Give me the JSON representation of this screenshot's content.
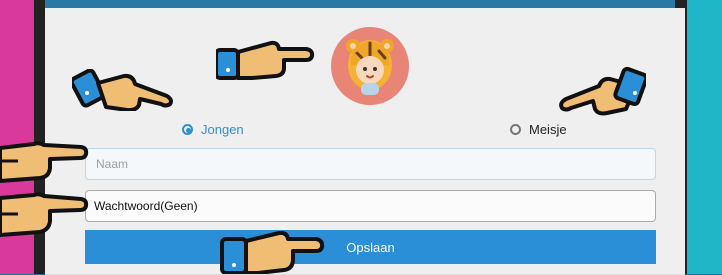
{
  "gender": {
    "options": [
      {
        "label": "Jongen",
        "selected": true
      },
      {
        "label": "Meisje",
        "selected": false
      }
    ]
  },
  "name_input": {
    "placeholder": "Naam",
    "value": ""
  },
  "password_input": {
    "value": "Wachtwoord(Geen)"
  },
  "save_button": {
    "label": "Opslaan"
  },
  "colors": {
    "accent": "#2a8fd7",
    "avatar_bg": "#e98576"
  }
}
